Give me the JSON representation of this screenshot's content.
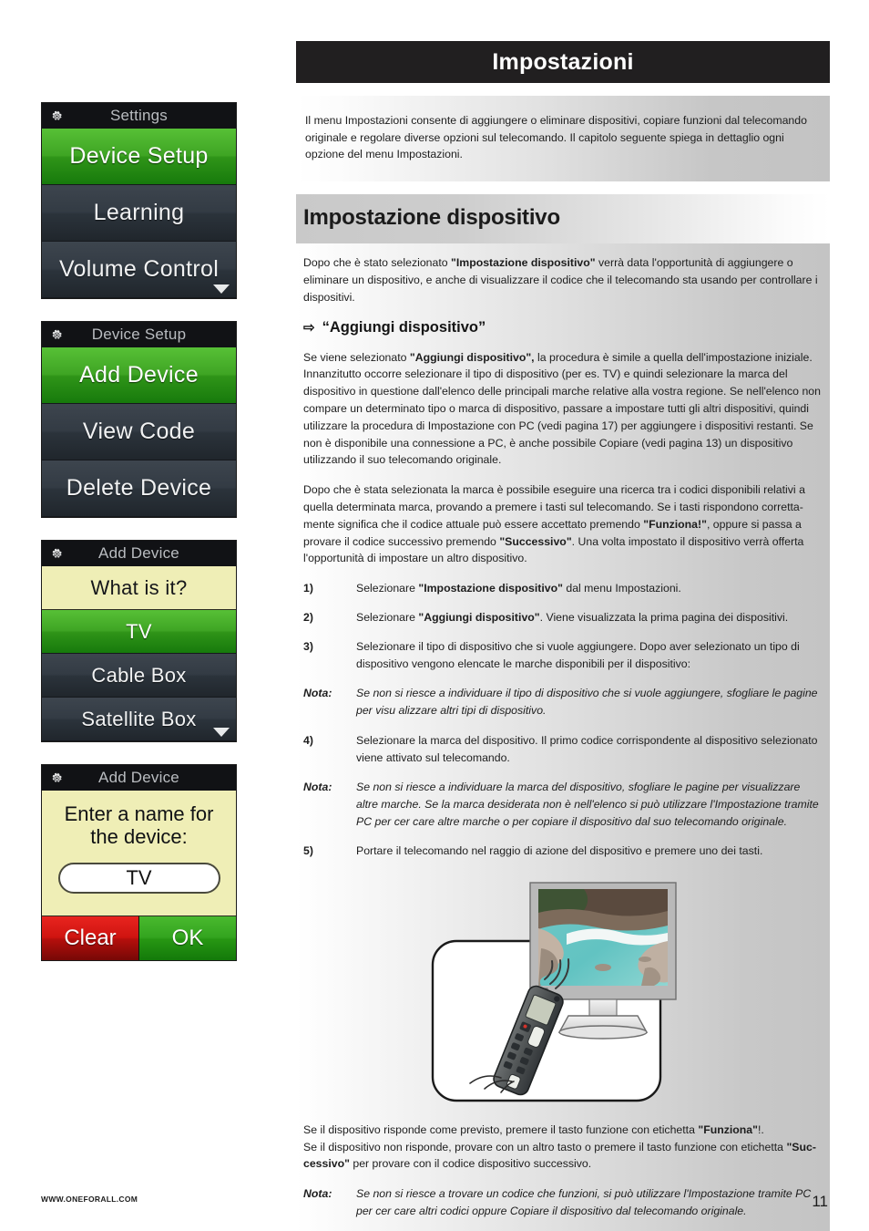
{
  "header": {
    "banner_title": "Impostazioni"
  },
  "intro": "Il menu Impostazioni consente di aggiungere o eliminare dispositivi, copiare funzioni dal telecomando originale e regolare diverse opzioni sul telecomando. Il capitolo seguente spiega in dettaglio ogni opzione del menu Impostazioni.",
  "section": {
    "heading": "Impostazione dispositivo",
    "para1_a": "Dopo che è stato selezionato ",
    "para1_b": "\"Impostazione dispositivo\"",
    "para1_c": " verrà data l'opportunità di aggiungere o eliminare un dispositivo, e anche di visualizzare il codice che il telecomando sta usando per controllare i dispositivi.",
    "sub_arrow": "⇨",
    "sub_heading": "“Aggiungi dispositivo”",
    "para2_a": "Se viene selezionato ",
    "para2_b": "\"Aggiungi dispositivo\",",
    "para2_c": " la procedura è simile a quella dell'impostazione iniziale. Innanzitutto occorre selezionare il tipo di dispositivo (per es. TV) e quindi selezionare la marca del dispositivo in questione dall'elenco delle principali marche relative alla vostra regione. Se nell'elenco non compare un determinato tipo o marca di dispositivo, passare a impostare tutti gli altri dispositivi, quindi utilizzare la procedura di Impostazione con PC (vedi pagina 17) per aggiungere i dispositivi restanti. Se non è disponibile una connessione a PC, è anche possibile Copiare (vedi pagina 13) un dispositivo utilizzando il suo telecomando originale.",
    "para3_a": "Dopo che è stata selezionata la marca è possibile eseguire una ricerca tra i codici disponibili relativi a quella determinata marca, provando a premere i tasti sul telecomando. Se i tasti rispondono corretta-mente significa che il codice attuale può essere accettato premendo ",
    "para3_b": "\"Funziona!\"",
    "para3_c": ", oppure si passa a provare il codice successivo premendo ",
    "para3_d": "\"Successivo\"",
    "para3_e": ". Una volta impostato il dispositivo verrà offerta l'opportunità di impostare un altro dispositivo."
  },
  "steps": [
    {
      "num": "1)",
      "kind": "step",
      "a": "Selezionare ",
      "b": "\"Impostazione dispositivo\"",
      "c": " dal menu Impostazioni."
    },
    {
      "num": "2)",
      "kind": "step",
      "a": "Selezionare ",
      "b": "\"Aggiungi dispositivo\"",
      "c": ". Viene visualizzata la prima pagina dei dispositivi."
    },
    {
      "num": "3)",
      "kind": "step",
      "a": "Selezionare il tipo di dispositivo che si vuole aggiungere. Dopo aver selezionato un tipo di dispositivo vengono elencate le marche disponibili per il dispositivo:",
      "b": "",
      "c": ""
    },
    {
      "num": "Nota:",
      "kind": "note",
      "a": "Se non si riesce a individuare il tipo di dispositivo che si vuole aggiungere, sfogliare le pagine per visu alizzare altri tipi di dispositivo.",
      "b": "",
      "c": ""
    },
    {
      "num": "4)",
      "kind": "step",
      "a": "Selezionare la marca del dispositivo. Il primo codice corrispondente al dispositivo selezionato viene attivato sul telecomando.",
      "b": "",
      "c": ""
    },
    {
      "num": "Nota:",
      "kind": "note",
      "a": "Se non si riesce a individuare la marca del dispositivo, sfogliare le pagine per visualizzare altre marche. Se la marca desiderata non è nell'elenco si può utilizzare l'Impostazione tramite PC per cer care altre marche o per copiare il dispositivo dal suo telecomando originale.",
      "b": "",
      "c": ""
    },
    {
      "num": "5)",
      "kind": "step",
      "a": "Portare il telecomando nel raggio di azione del dispositivo e premere uno dei tasti.",
      "b": "",
      "c": ""
    }
  ],
  "closing": {
    "line1_a": "Se il dispositivo risponde come previsto, premere il tasto funzione con etichetta ",
    "line1_b": "\"Funziona\"",
    "line1_c": "!.",
    "line2_a": "Se il dispositivo non risponde, provare con un altro tasto o premere il tasto funzione con etichetta ",
    "line2_b": "\"Suc-cessivo\"",
    "line2_c": " per provare con il codice dispositivo successivo.",
    "note_label": "Nota:",
    "note_text": "Se non si riesce a trovare un codice che funzioni, si può utilizzare l'Impostazione tramite PC per cer care altri codici oppure Copiare il dispositivo dal telecomando originale."
  },
  "screens": [
    {
      "id": "settings",
      "icon": "gear-icon",
      "title": "Settings",
      "rows": [
        {
          "label": "Device Setup",
          "state": "selected"
        },
        {
          "label": "Learning",
          "state": "normal"
        },
        {
          "label": "Volume Control",
          "state": "normal"
        }
      ],
      "scroll_indicator": true
    },
    {
      "id": "device-setup",
      "icon": "gear-icon",
      "title": "Device Setup",
      "rows": [
        {
          "label": "Add Device",
          "state": "selected"
        },
        {
          "label": "View Code",
          "state": "normal"
        },
        {
          "label": "Delete Device",
          "state": "normal"
        }
      ],
      "scroll_indicator": false
    },
    {
      "id": "add-device-type",
      "icon": "gear-icon",
      "title": "Add Device",
      "rows": [
        {
          "label": "What is it?",
          "state": "prompt"
        },
        {
          "label": "TV",
          "state": "selected"
        },
        {
          "label": "Cable Box",
          "state": "normal"
        },
        {
          "label": "Satellite Box",
          "state": "normal"
        }
      ],
      "scroll_indicator": true
    },
    {
      "id": "add-device-name",
      "icon": "gear-icon",
      "title": "Add Device",
      "prompt": "Enter a name for\nthe device:",
      "name_value": "TV",
      "buttons": [
        {
          "label": "Clear",
          "color": "red"
        },
        {
          "label": "OK",
          "color": "green"
        }
      ]
    }
  ],
  "footer": {
    "site": "WWW.ONEFORALL.COM",
    "page_number": "11"
  },
  "colors": {
    "banner_bg": "#211f20",
    "accent_green": "#2f9418",
    "accent_red": "#cf1410",
    "screen_dark": "#2f3740",
    "screen_cream": "#efeeb6"
  }
}
